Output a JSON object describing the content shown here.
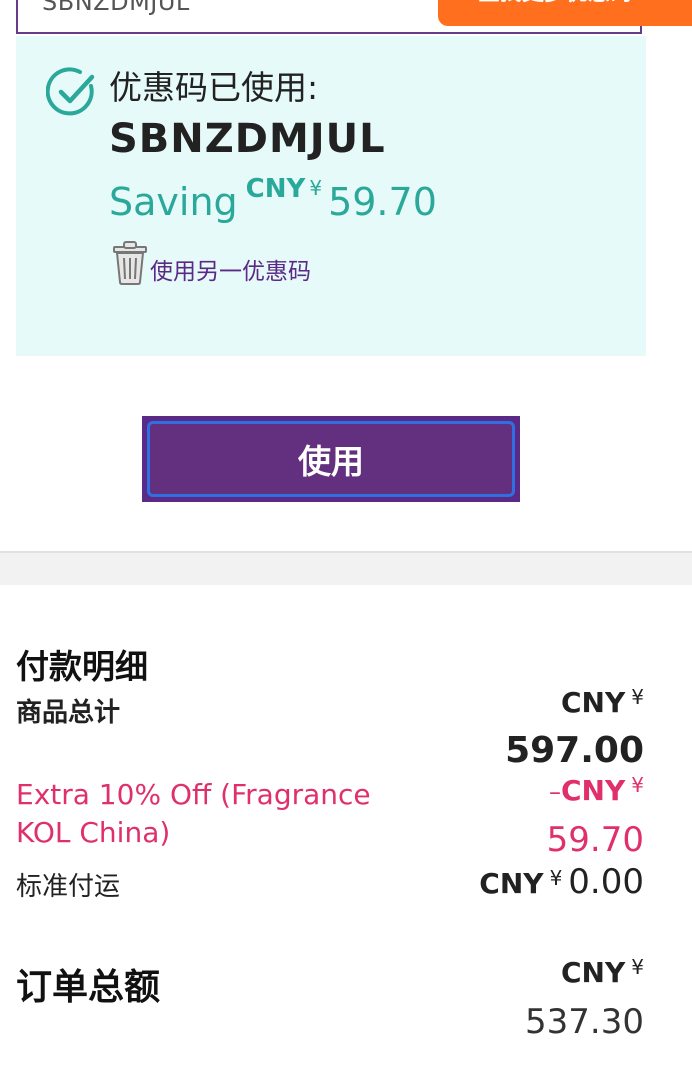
{
  "coupon_input": {
    "value": "SBNZDMJUL"
  },
  "top_button": {
    "label": "查找更多优惠码"
  },
  "promo": {
    "applied_label": "优惠码已使用:",
    "code": "SBNZDMJUL",
    "saving_word": "Saving",
    "currency": "CNY",
    "yen": "¥",
    "amount": "59.70",
    "use_another": "使用另一优惠码"
  },
  "apply_button": {
    "label": "使用"
  },
  "summary": {
    "title": "付款明细",
    "subtotal_label": "商品总计",
    "subtotal_currency": "CNY",
    "subtotal_yen": "¥",
    "subtotal_value": "597.00",
    "discount_label": "Extra 10% Off (Fragrance KOL China)",
    "discount_minus": "–",
    "discount_currency": "CNY",
    "discount_yen": "¥",
    "discount_value": "59.70",
    "shipping_label": "标准付运",
    "shipping_currency": "CNY",
    "shipping_yen": "¥",
    "shipping_value": "0.00",
    "total_label": "订单总额",
    "total_currency": "CNY",
    "total_yen": "¥",
    "total_value": "537.30"
  },
  "colors": {
    "brand_purple": "#5b2a86",
    "teal": "#2aa89a",
    "promo_bg": "#e6fafa",
    "orange": "#ff6f1e",
    "discount_pink": "#e0306c"
  },
  "icons": [
    "check-circle-icon",
    "trash-icon"
  ]
}
